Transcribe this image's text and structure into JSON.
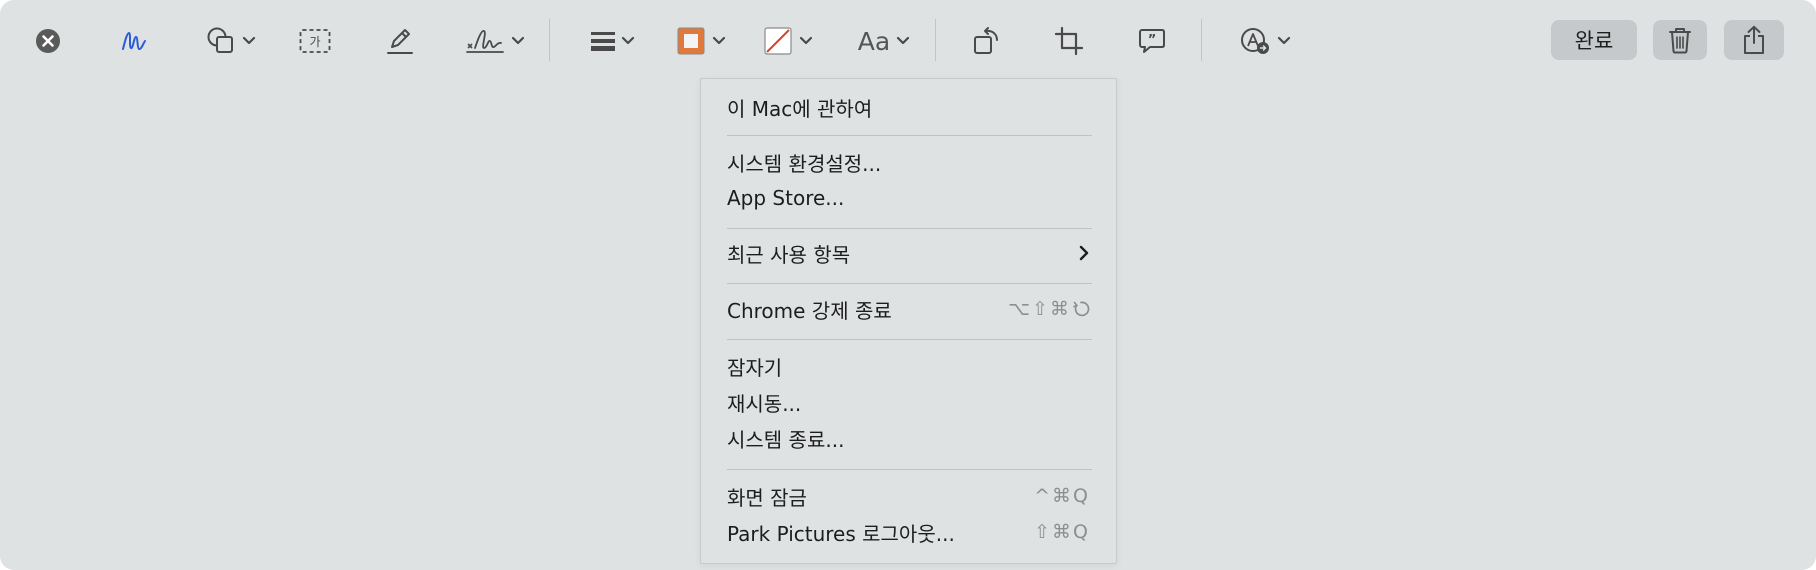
{
  "toolbar": {
    "done_label": "완료",
    "text_style_label": "Aa",
    "tools": [
      {
        "name": "close-circle-icon"
      },
      {
        "name": "sketch-icon"
      },
      {
        "name": "shapes-icon"
      },
      {
        "name": "text-box-icon",
        "glyph": "가"
      },
      {
        "name": "highlight-pen-icon"
      },
      {
        "name": "signature-icon"
      },
      {
        "name": "line-weight-icon"
      },
      {
        "name": "border-color-icon"
      },
      {
        "name": "fill-color-icon"
      },
      {
        "name": "text-style-icon"
      },
      {
        "name": "rotate-icon"
      },
      {
        "name": "crop-icon"
      },
      {
        "name": "description-icon"
      },
      {
        "name": "auto-fill-icon"
      },
      {
        "name": "trash-icon"
      },
      {
        "name": "share-icon"
      }
    ],
    "colors": {
      "accent_blue": "#2a5dd6",
      "border_orange": "#e07a3c",
      "no_fill_red": "#d64532"
    }
  },
  "menu": {
    "items": [
      {
        "label": "이 Mac에 관하여",
        "shortcut": ""
      },
      {
        "label": "시스템 환경설정...",
        "shortcut": ""
      },
      {
        "label": "App Store...",
        "shortcut": ""
      },
      {
        "label": "최근 사용 항목",
        "shortcut": "",
        "submenu": true
      },
      {
        "label": "Chrome 강제 종료",
        "shortcut": "⌥⇧⌘"
      },
      {
        "label": "잠자기",
        "shortcut": ""
      },
      {
        "label": "재시동...",
        "shortcut": ""
      },
      {
        "label": "시스템 종료...",
        "shortcut": ""
      },
      {
        "label": "화면 잠금",
        "shortcut": "^⌘Q"
      },
      {
        "label": "Park Pictures 로그아웃...",
        "shortcut": "⇧⌘Q"
      }
    ]
  }
}
